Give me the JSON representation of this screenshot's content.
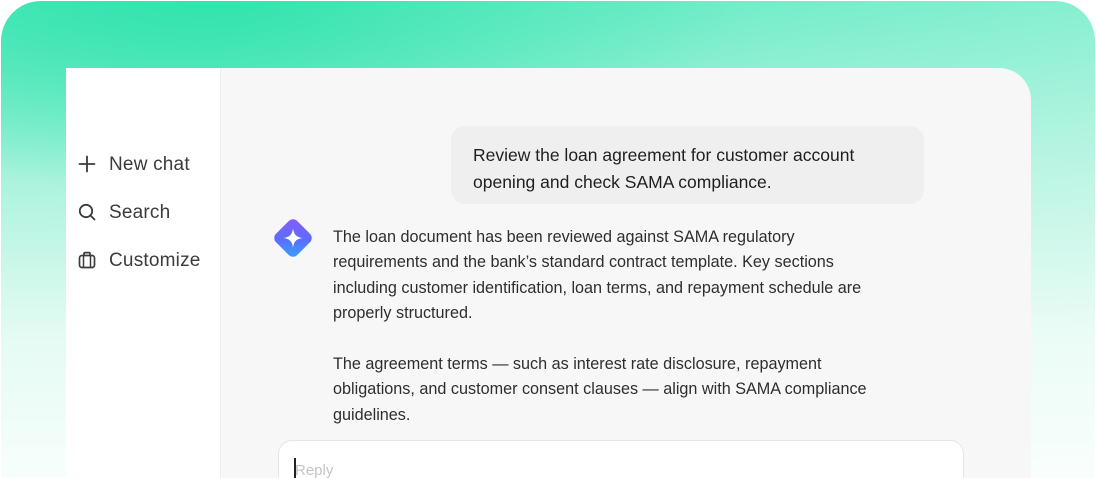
{
  "sidebar": {
    "items": [
      {
        "label": "New chat",
        "icon": "plus-icon"
      },
      {
        "label": "Search",
        "icon": "search-icon"
      },
      {
        "label": "Customize",
        "icon": "briefcase-icon"
      }
    ]
  },
  "conversation": {
    "user_message": "Review the loan agreement for customer account opening and check SAMA compliance.",
    "assistant_icon": "sparkle-icon",
    "assistant_paragraphs": [
      "The loan document has been reviewed against SAMA regulatory requirements and the bank’s standard contract template. Key sections including customer identification, loan terms, and repayment schedule are properly structured.",
      "The agreement terms — such as interest rate disclosure, repayment obligations, and customer consent clauses — align with SAMA compliance guidelines."
    ]
  },
  "composer": {
    "placeholder": "Reply"
  },
  "colors": {
    "accent_green": "#2ee2aa",
    "avatar_gradient_start": "#7b61ff",
    "avatar_gradient_end": "#3aa0ff"
  }
}
